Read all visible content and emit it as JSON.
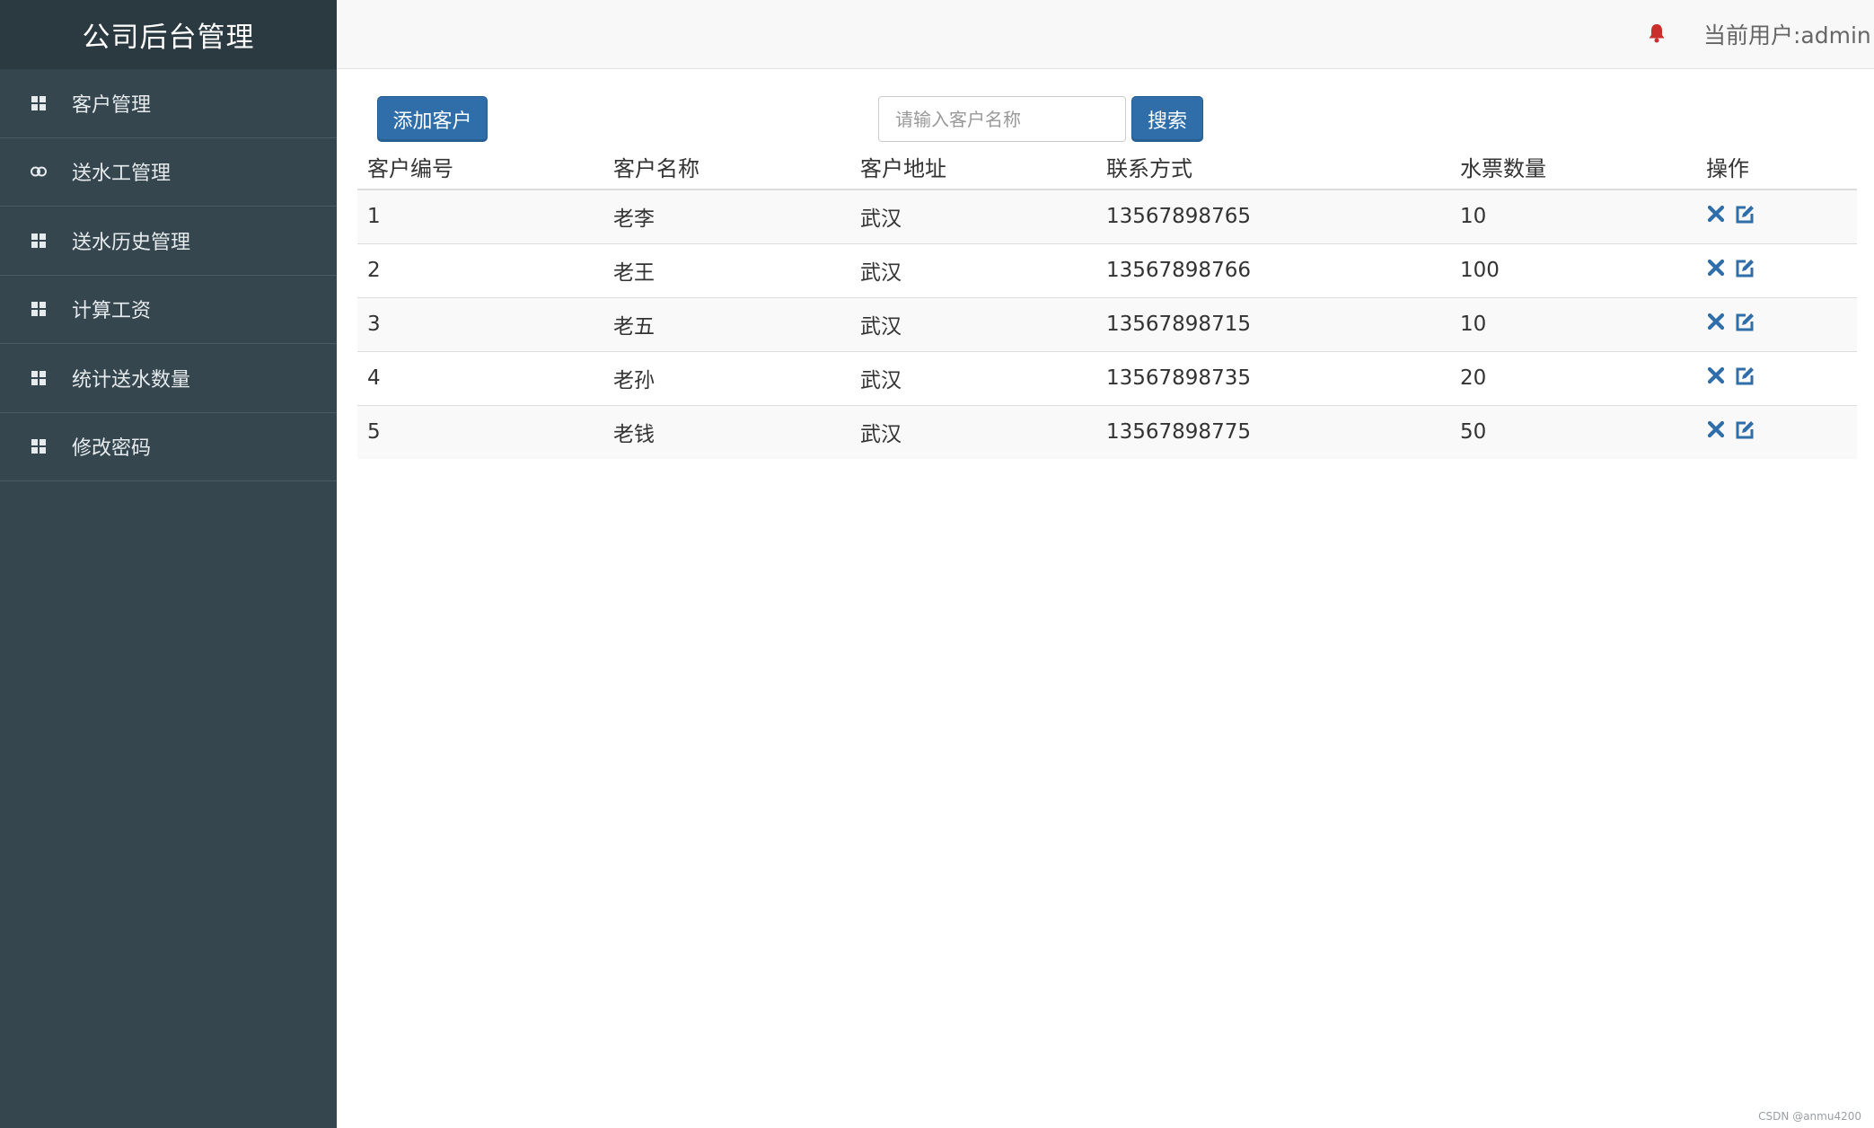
{
  "app": {
    "title": "公司后台管理"
  },
  "sidebar": {
    "items": [
      {
        "label": "客户管理",
        "icon": "grid-icon"
      },
      {
        "label": "送水工管理",
        "icon": "link-icon"
      },
      {
        "label": "送水历史管理",
        "icon": "grid-icon"
      },
      {
        "label": "计算工资",
        "icon": "grid-icon"
      },
      {
        "label": "统计送水数量",
        "icon": "grid-icon"
      },
      {
        "label": "修改密码",
        "icon": "grid-icon"
      }
    ]
  },
  "header": {
    "current_user": "当前用户:admin",
    "bell_icon": "bell-icon",
    "bell_color": "#c9302c"
  },
  "toolbar": {
    "add_label": "添加客户",
    "search_placeholder": "请输入客户名称",
    "search_value": "",
    "search_label": "搜索"
  },
  "table": {
    "headers": [
      "客户编号",
      "客户名称",
      "客户地址",
      "联系方式",
      "水票数量",
      "操作"
    ],
    "rows": [
      [
        "1",
        "老李",
        "武汉",
        "13567898765",
        "10"
      ],
      [
        "2",
        "老王",
        "武汉",
        "13567898766",
        "100"
      ],
      [
        "3",
        "老五",
        "武汉",
        "13567898715",
        "10"
      ],
      [
        "4",
        "老孙",
        "武汉",
        "13567898735",
        "20"
      ],
      [
        "5",
        "老钱",
        "武汉",
        "13567898775",
        "50"
      ]
    ],
    "actions": [
      "delete-icon",
      "edit-icon"
    ],
    "action_color": "#2f6ea9"
  },
  "colors": {
    "sidebar_bg": "#36464f",
    "brand_bg": "#2b3941",
    "primary": "#2f6ea9"
  },
  "watermark": "CSDN @anmu4200"
}
